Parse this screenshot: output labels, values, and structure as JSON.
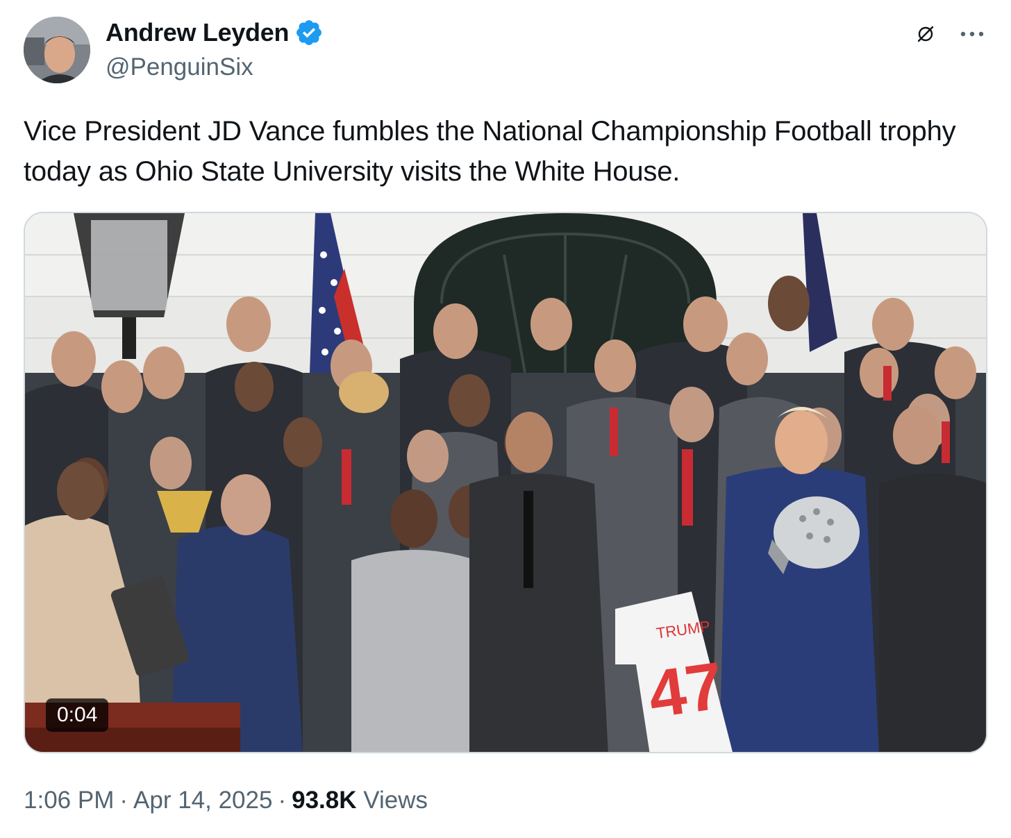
{
  "author": {
    "name": "Andrew Leyden",
    "handle": "@PenguinSix",
    "verified": true,
    "verified_color": "#1d9bf0",
    "avatar_icon": "avatar-photo"
  },
  "header_icons": [
    "grok-icon",
    "more-icon"
  ],
  "tweet": {
    "text": "Vice President JD Vance fumbles the National Championship Football trophy today as Ohio State University visits the White House."
  },
  "media": {
    "type": "video",
    "duration": "0:04",
    "jersey_name": "TRUMP",
    "jersey_number": "47"
  },
  "meta": {
    "time": "1:06 PM",
    "separator": "·",
    "date": "Apr 14, 2025",
    "views_count": "93.8K",
    "views_label": "Views"
  }
}
